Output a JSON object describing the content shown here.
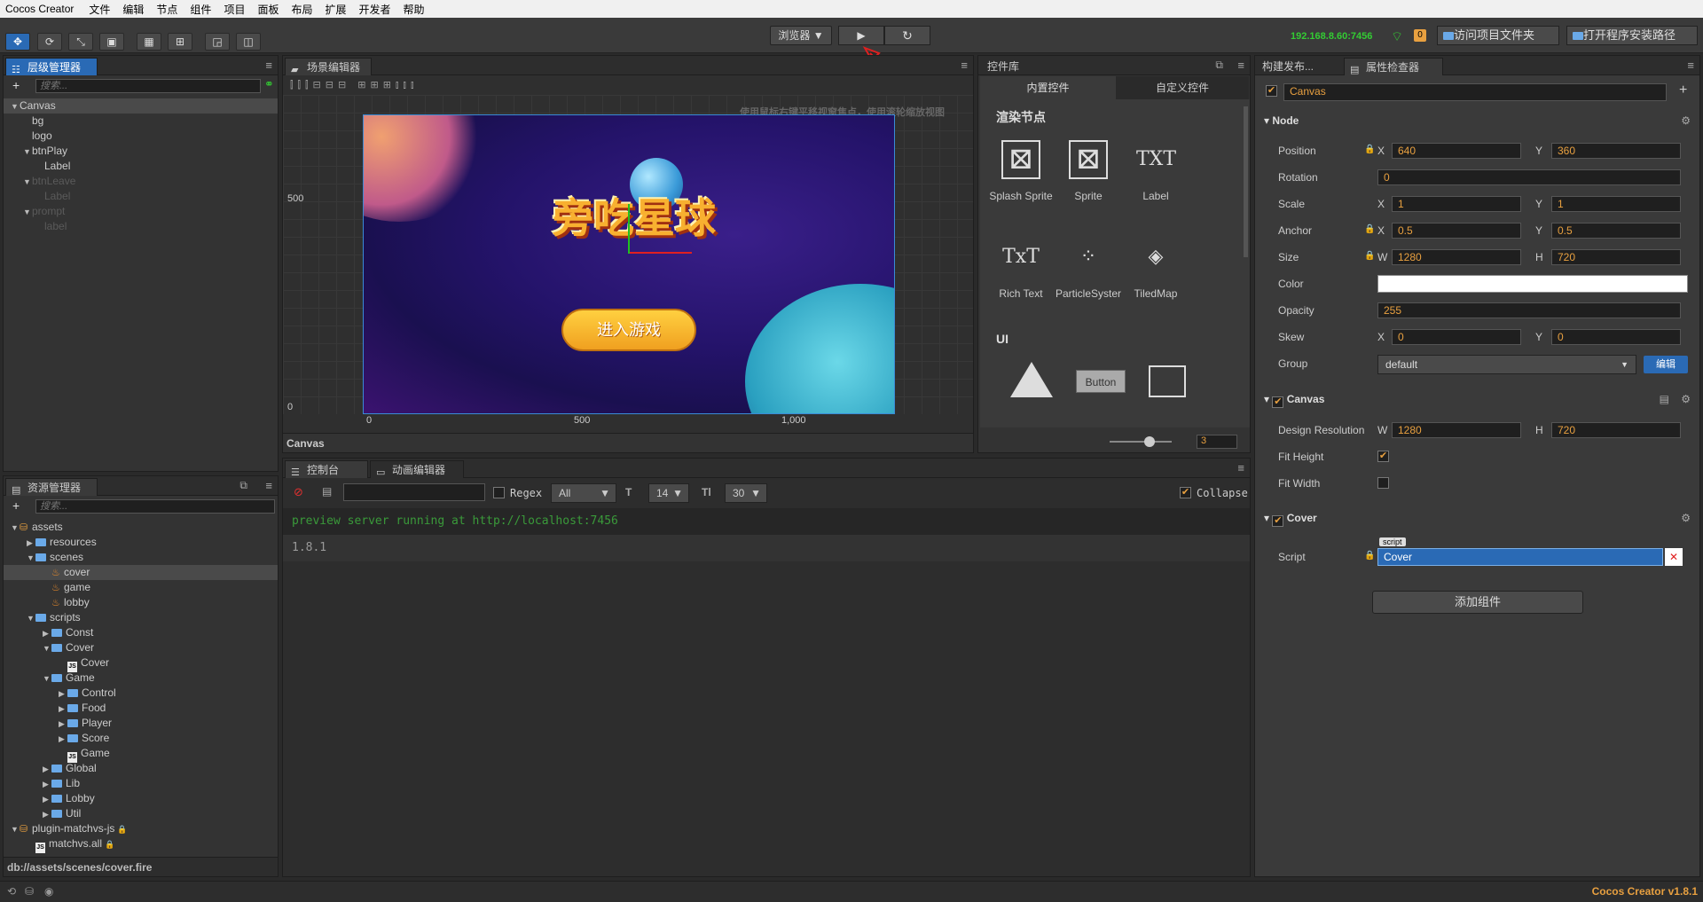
{
  "menubar": {
    "app": "Cocos Creator",
    "items": [
      "文件",
      "编辑",
      "节点",
      "组件",
      "项目",
      "面板",
      "布局",
      "扩展",
      "开发者",
      "帮助"
    ]
  },
  "toolbar": {
    "platform": "浏览器 ▼",
    "play": "▶",
    "reload": "↻",
    "ip": "192.168.8.60:7456",
    "badge": "0",
    "open_project": "访问项目文件夹",
    "open_install": "打开程序安装路径"
  },
  "hierarchy": {
    "tab": "层级管理器",
    "search_placeholder": "搜索...",
    "nodes": [
      {
        "label": "Canvas",
        "depth": 0,
        "arrow": "▼",
        "state": "sel"
      },
      {
        "label": "bg",
        "depth": 1,
        "arrow": "",
        "state": ""
      },
      {
        "label": "logo",
        "depth": 1,
        "arrow": "",
        "state": ""
      },
      {
        "label": "btnPlay",
        "depth": 1,
        "arrow": "▼",
        "state": ""
      },
      {
        "label": "Label",
        "depth": 2,
        "arrow": "",
        "state": ""
      },
      {
        "label": "btnLeave",
        "depth": 1,
        "arrow": "▼",
        "state": "dim"
      },
      {
        "label": "Label",
        "depth": 2,
        "arrow": "",
        "state": "dim"
      },
      {
        "label": "prompt",
        "depth": 1,
        "arrow": "▼",
        "state": "dim"
      },
      {
        "label": "label",
        "depth": 2,
        "arrow": "",
        "state": "dim"
      }
    ]
  },
  "assets": {
    "tab": "资源管理器",
    "search_placeholder": "搜索...",
    "path": "db://assets/scenes/cover.fire",
    "items": [
      {
        "label": "assets",
        "depth": 0,
        "arrow": "▼",
        "icon": "db"
      },
      {
        "label": "resources",
        "depth": 1,
        "arrow": "▶",
        "icon": "folder"
      },
      {
        "label": "scenes",
        "depth": 1,
        "arrow": "▼",
        "icon": "folder"
      },
      {
        "label": "cover",
        "depth": 2,
        "arrow": "",
        "icon": "fire",
        "state": "sel"
      },
      {
        "label": "game",
        "depth": 2,
        "arrow": "",
        "icon": "fire"
      },
      {
        "label": "lobby",
        "depth": 2,
        "arrow": "",
        "icon": "fire"
      },
      {
        "label": "scripts",
        "depth": 1,
        "arrow": "▼",
        "icon": "folder"
      },
      {
        "label": "Const",
        "depth": 2,
        "arrow": "▶",
        "icon": "folder"
      },
      {
        "label": "Cover",
        "depth": 2,
        "arrow": "▼",
        "icon": "folder"
      },
      {
        "label": "Cover",
        "depth": 3,
        "arrow": "",
        "icon": "js"
      },
      {
        "label": "Game",
        "depth": 2,
        "arrow": "▼",
        "icon": "folder"
      },
      {
        "label": "Control",
        "depth": 3,
        "arrow": "▶",
        "icon": "folder"
      },
      {
        "label": "Food",
        "depth": 3,
        "arrow": "▶",
        "icon": "folder"
      },
      {
        "label": "Player",
        "depth": 3,
        "arrow": "▶",
        "icon": "folder"
      },
      {
        "label": "Score",
        "depth": 3,
        "arrow": "▶",
        "icon": "folder"
      },
      {
        "label": "Game",
        "depth": 3,
        "arrow": "",
        "icon": "js"
      },
      {
        "label": "Global",
        "depth": 2,
        "arrow": "▶",
        "icon": "folder"
      },
      {
        "label": "Lib",
        "depth": 2,
        "arrow": "▶",
        "icon": "folder"
      },
      {
        "label": "Lobby",
        "depth": 2,
        "arrow": "▶",
        "icon": "folder"
      },
      {
        "label": "Util",
        "depth": 2,
        "arrow": "▶",
        "icon": "folder"
      },
      {
        "label": "plugin-matchvs-js",
        "depth": 0,
        "arrow": "▼",
        "icon": "db",
        "lock": "🔒"
      },
      {
        "label": "matchvs.all",
        "depth": 1,
        "arrow": "",
        "icon": "js",
        "lock": "🔒"
      }
    ]
  },
  "scene": {
    "tab": "场景编辑器",
    "hint": "使用鼠标右键平移视窗焦点，使用滚轮缩放视图",
    "y500": "500",
    "y0": "0",
    "x0": "0",
    "x500": "500",
    "x1000": "1,000",
    "node": "Canvas",
    "game_title": "旁吃星球",
    "play_btn": "进入游戏"
  },
  "widgets": {
    "tab": "控件库",
    "tab_builtin": "内置控件",
    "tab_custom": "自定义控件",
    "section_render": "渲染节点",
    "section_ui": "UI",
    "items": [
      {
        "label": "Splash Sprite",
        "glyph": "⊠"
      },
      {
        "label": "Sprite",
        "glyph": "⊠"
      },
      {
        "label": "Label",
        "glyph": "TXT"
      },
      {
        "label": "Rich Text",
        "glyph": "TxT"
      },
      {
        "label": "ParticleSyster",
        "glyph": "⁘"
      },
      {
        "label": "TiledMap",
        "glyph": "◈"
      }
    ],
    "ui_button": "Button",
    "zoom": "3"
  },
  "console": {
    "tab": "控制台",
    "tab_anim": "动画编辑器",
    "regex": "Regex",
    "filter": "All",
    "font": "14",
    "lines_count": "30",
    "collapse": "Collapse",
    "lines": [
      "preview server running at http://localhost:7456",
      "1.8.1"
    ]
  },
  "inspector": {
    "tab_build": "构建发布...",
    "tab": "属性检查器",
    "node_name": "Canvas",
    "node_section": "Node",
    "position": {
      "label": "Position",
      "x": "640",
      "y": "360"
    },
    "rotation": {
      "label": "Rotation",
      "v": "0"
    },
    "scale": {
      "label": "Scale",
      "x": "1",
      "y": "1"
    },
    "anchor": {
      "label": "Anchor",
      "x": "0.5",
      "y": "0.5"
    },
    "size": {
      "label": "Size",
      "w": "1280",
      "h": "720"
    },
    "color": {
      "label": "Color"
    },
    "opacity": {
      "label": "Opacity",
      "v": "255"
    },
    "skew": {
      "label": "Skew",
      "x": "0",
      "y": "0"
    },
    "group": {
      "label": "Group",
      "v": "default",
      "edit": "编辑"
    },
    "canvas_section": "Canvas",
    "design": {
      "label": "Design Resolution",
      "w": "1280",
      "h": "720"
    },
    "fit_height": "Fit Height",
    "fit_width": "Fit Width",
    "cover_section": "Cover",
    "script": {
      "label": "Script",
      "tag": "script",
      "v": "Cover"
    },
    "add": "添加组件",
    "X": "X",
    "Y": "Y",
    "W": "W",
    "H": "H"
  },
  "status": {
    "version": "Cocos Creator v1.8.1"
  }
}
